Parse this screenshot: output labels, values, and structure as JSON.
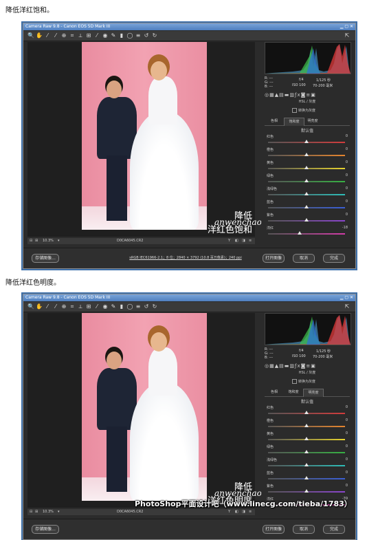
{
  "captions": {
    "first": "降低洋红饱和。",
    "second": "降低洋红色明度。"
  },
  "windows": [
    {
      "title": "Camera Raw 9.8 - Canon EOS 5D Mark III",
      "overlay_line1": "降低",
      "overlay_line2": "洋红色饱和",
      "watermark": "anwenchao",
      "watermark_sub": "安文超 高端修图",
      "zoom": "10.3%",
      "filename": "D0CA6045.CR2",
      "workflow": "sRGB IEC61966-2.1；8 位；2840 × 3792 (10.8 百万像素)；240 ppi",
      "camera_info": {
        "aperture": "f/4",
        "shutter": "1/125 秒",
        "iso": "ISO 100",
        "lens": "70-200 毫米"
      },
      "rgb": [
        "R: ---",
        "G: ---",
        "B: ---"
      ],
      "section_title": "HSL / 灰度",
      "checkbox": "转换为灰度",
      "tabs": [
        "色相",
        "饱和度",
        "明亮度"
      ],
      "active_tab": 1,
      "sub_title": "默认值",
      "sliders": [
        {
          "label": "红色",
          "value": "0",
          "pos": 0.5
        },
        {
          "label": "橙色",
          "value": "0",
          "pos": 0.5
        },
        {
          "label": "黄色",
          "value": "0",
          "pos": 0.5
        },
        {
          "label": "绿色",
          "value": "0",
          "pos": 0.5
        },
        {
          "label": "浅绿色",
          "value": "0",
          "pos": 0.5
        },
        {
          "label": "蓝色",
          "value": "0",
          "pos": 0.5
        },
        {
          "label": "紫色",
          "value": "0",
          "pos": 0.5
        },
        {
          "label": "洋红",
          "value": "-18",
          "pos": 0.41
        }
      ],
      "buttons": {
        "save": "存储图像...",
        "open": "打开图像",
        "cancel": "取消",
        "done": "完成"
      }
    },
    {
      "title": "Camera Raw 9.8 - Canon EOS 5D Mark III",
      "overlay_line1": "降低",
      "overlay_line2": "洋红色明度",
      "watermark": "anwenchao",
      "watermark_sub": "安文超 高端修图",
      "zoom": "10.3%",
      "filename": "D0CA6045.CR2",
      "workflow": "",
      "camera_info": {
        "aperture": "f/4",
        "shutter": "1/125 秒",
        "iso": "ISO 100",
        "lens": "70-200 毫米"
      },
      "rgb": [
        "R: ---",
        "G: ---",
        "B: ---"
      ],
      "section_title": "HSL / 灰度",
      "checkbox": "转换为灰度",
      "tabs": [
        "色相",
        "饱和度",
        "明亮度"
      ],
      "active_tab": 2,
      "sub_title": "默认值",
      "sliders": [
        {
          "label": "红色",
          "value": "0",
          "pos": 0.5
        },
        {
          "label": "橙色",
          "value": "0",
          "pos": 0.5
        },
        {
          "label": "黄色",
          "value": "0",
          "pos": 0.5
        },
        {
          "label": "绿色",
          "value": "0",
          "pos": 0.5
        },
        {
          "label": "浅绿色",
          "value": "0",
          "pos": 0.5
        },
        {
          "label": "蓝色",
          "value": "0",
          "pos": 0.5
        },
        {
          "label": "紫色",
          "value": "0",
          "pos": 0.5
        },
        {
          "label": "洋红",
          "value": "-39",
          "pos": 0.31
        }
      ],
      "buttons": {
        "save": "存储图像...",
        "open": "打开图像",
        "cancel": "取消",
        "done": "完成"
      }
    }
  ],
  "slider_colors": [
    "#d23c3c",
    "#e6852e",
    "#e6d22e",
    "#37b043",
    "#2ebdb8",
    "#3a5fd6",
    "#8a45cc",
    "#d23ca8"
  ],
  "credit": "PhotoShop平面设计吧（www.linecg.com/tieba/1783）"
}
